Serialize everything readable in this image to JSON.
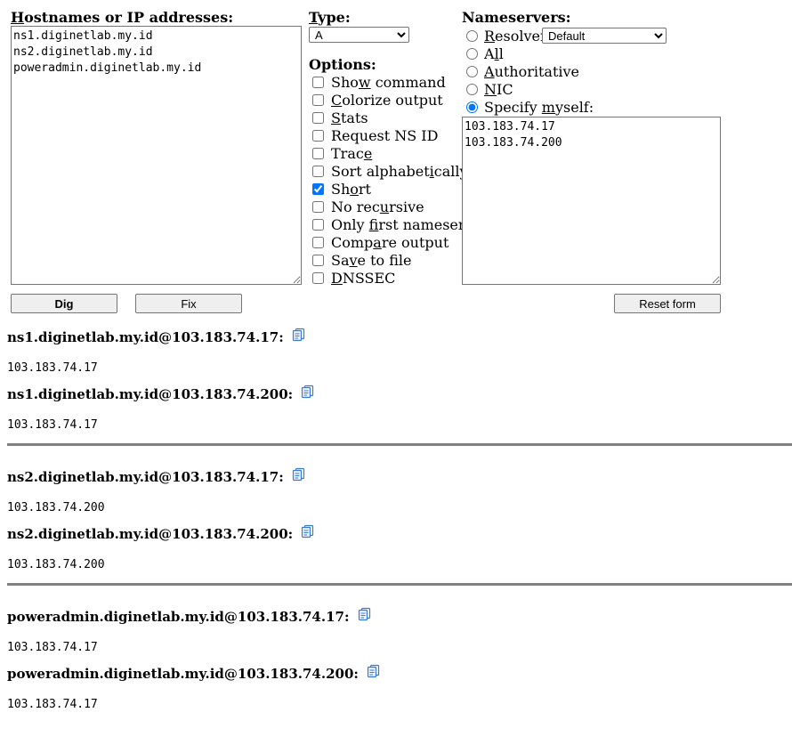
{
  "form": {
    "hostnames_label_first": "H",
    "hostnames_label_rest": "ostnames or IP addresses:",
    "hostnames_value": "ns1.diginetlab.my.id\nns2.diginetlab.my.id\npoweradmin.diginetlab.my.id",
    "type_label_first": "T",
    "type_label_rest": "ype:",
    "type_selected": "A",
    "options_label": "Options:",
    "options": [
      {
        "pre": "Sho",
        "ul": "w",
        "post": " command",
        "checked": false
      },
      {
        "pre": "",
        "ul": "C",
        "post": "olorize output",
        "checked": false
      },
      {
        "pre": "",
        "ul": "S",
        "post": "tats",
        "checked": false
      },
      {
        "pre": "Request NS ID",
        "ul": "",
        "post": "",
        "checked": false
      },
      {
        "pre": "Trac",
        "ul": "e",
        "post": "",
        "checked": false
      },
      {
        "pre": "Sort alphabet",
        "ul": "i",
        "post": "cally",
        "checked": false
      },
      {
        "pre": "Sh",
        "ul": "o",
        "post": "rt",
        "checked": true
      },
      {
        "pre": "No rec",
        "ul": "u",
        "post": "rsive",
        "checked": false
      },
      {
        "pre": "Only ",
        "ul": "f",
        "post": "irst nameserver",
        "checked": false
      },
      {
        "pre": "Comp",
        "ul": "a",
        "post": "re output",
        "checked": false
      },
      {
        "pre": "Sa",
        "ul": "v",
        "post": "e to file",
        "checked": false
      },
      {
        "pre": "",
        "ul": "D",
        "post": "NSSEC",
        "checked": false
      }
    ],
    "nameservers_label": "Nameservers:",
    "nameservers": [
      {
        "pre": "",
        "ul": "R",
        "post": "esolver:",
        "selected": false
      },
      {
        "pre": "A",
        "ul": "l",
        "post": "l",
        "selected": false
      },
      {
        "pre": "",
        "ul": "A",
        "post": "uthoritative",
        "selected": false
      },
      {
        "pre": "",
        "ul": "N",
        "post": "IC",
        "selected": false
      },
      {
        "pre": "Specify ",
        "ul": "m",
        "post": "yself:",
        "selected": true
      }
    ],
    "resolver_selected": "Default",
    "specify_value": "103.183.74.17\n103.183.74.200",
    "dig_button": "Dig",
    "fix_button": "Fix",
    "reset_button": "Reset form"
  },
  "results": [
    {
      "header": "ns1.diginetlab.my.id@103.183.74.17:",
      "value": "103.183.74.17"
    },
    {
      "header": "ns1.diginetlab.my.id@103.183.74.200:",
      "value": "103.183.74.17"
    },
    {
      "header": "ns2.diginetlab.my.id@103.183.74.17:",
      "value": "103.183.74.200"
    },
    {
      "header": "ns2.diginetlab.my.id@103.183.74.200:",
      "value": "103.183.74.200"
    },
    {
      "header": "poweradmin.diginetlab.my.id@103.183.74.17:",
      "value": "103.183.74.17"
    },
    {
      "header": "poweradmin.diginetlab.my.id@103.183.74.200:",
      "value": "103.183.74.17"
    }
  ],
  "icons": {
    "copy": "copy-clipboard-icon"
  },
  "colors": {
    "icon_blue": "#3a7ad6",
    "divider": "#808080"
  }
}
